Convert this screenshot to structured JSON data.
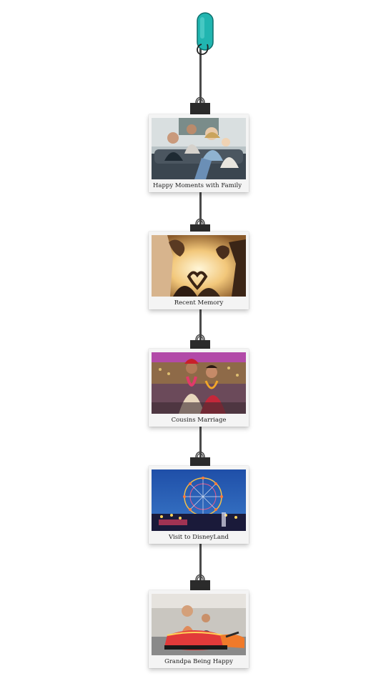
{
  "photos": [
    {
      "caption": "Happy Moments with Family",
      "scene": "family-on-sofa"
    },
    {
      "caption": "Recent Memory",
      "scene": "heart-hands-sunset"
    },
    {
      "caption": "Cousins Marriage",
      "scene": "wedding-couple"
    },
    {
      "caption": "Visit to DisneyLand",
      "scene": "ferris-wheel-night"
    },
    {
      "caption": "Grandpa Being Happy",
      "scene": "bumper-cars"
    }
  ],
  "icons": {
    "hook": "wall-hook-icon",
    "clip": "binder-clip-icon"
  },
  "colors": {
    "hook": "#21b5b0",
    "string": "#4a4a4a",
    "clip": "#2b2b2b",
    "frame": "#f4f4f4"
  }
}
